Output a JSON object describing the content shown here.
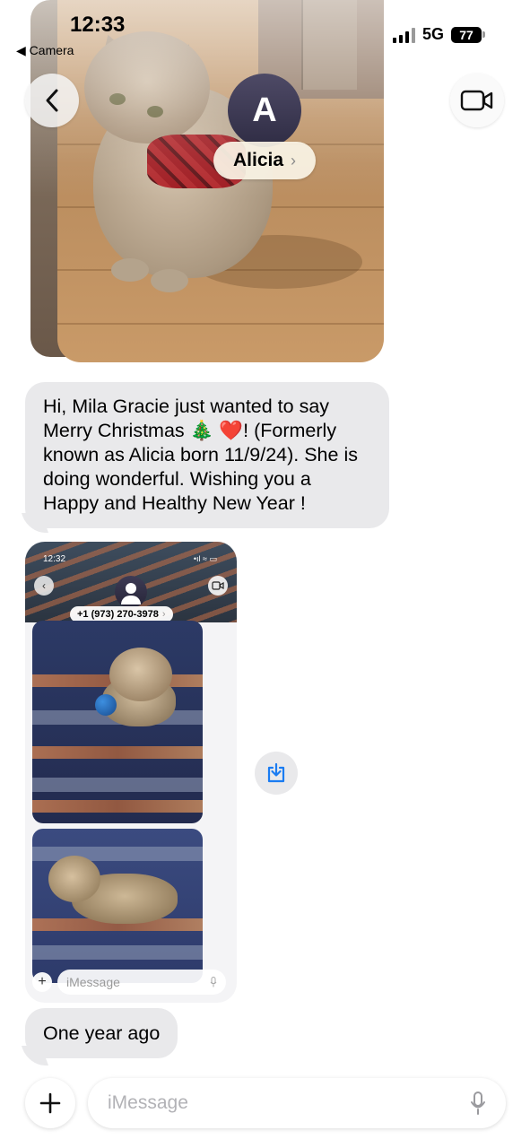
{
  "status_bar": {
    "time": "12:33",
    "back_app": "Camera",
    "network": "5G",
    "battery": "77"
  },
  "header": {
    "avatar_initial": "A",
    "contact_name": "Alicia",
    "chevron": "›"
  },
  "messages": [
    {
      "type": "text",
      "text": "Hi, Mila Gracie just wanted to say Merry Christmas 🎄 ❤️! (Formerly known as Alicia born 11/9/24).  She is doing wonderful.  Wishing you a Happy and Healthy New Year !"
    },
    {
      "type": "screenshot",
      "inner": {
        "time": "12:32",
        "signal": "•ıl ≈ ▭",
        "contact": "+1 (973) 270-3978",
        "chevron": "›",
        "plus": "+",
        "input_placeholder": "iMessage"
      }
    },
    {
      "type": "text",
      "text": "One year ago"
    }
  ],
  "composer": {
    "placeholder": "iMessage",
    "plus": "+"
  },
  "colors": {
    "bubble_gray": "#e9e9eb",
    "avatar": "#3b3853",
    "accent_blue": "#1a7cf2"
  },
  "icons": [
    "chevron-left-icon",
    "video-camera-icon",
    "download-icon",
    "plus-icon",
    "microphone-icon",
    "signal-icon",
    "battery-icon",
    "person-icon"
  ]
}
